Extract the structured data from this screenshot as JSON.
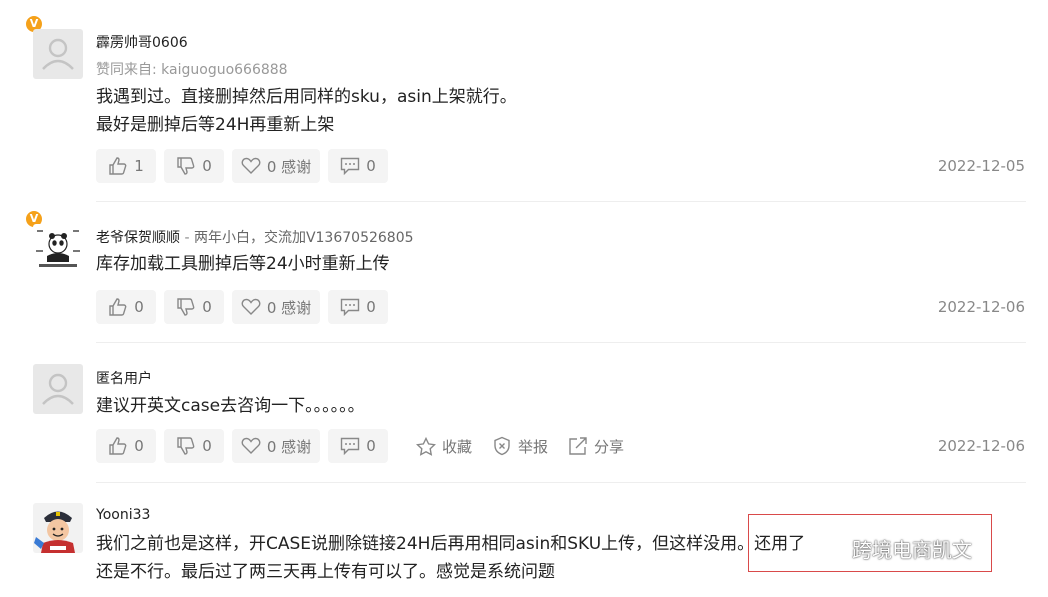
{
  "comments": [
    {
      "username": "霹雳帅哥0606",
      "verified_badge": "V",
      "sub_label": "赞同来自: kaiguoguo666888",
      "body_lines": [
        "我遇到过。直接删掉然后用同样的sku，asin上架就行。",
        "最好是删掉后等24H再重新上架"
      ],
      "likes": "1",
      "dislikes": "0",
      "thanks": "0 感谢",
      "replies": "0",
      "date": "2022-12-05"
    },
    {
      "username": "老爷保贺顺顺",
      "separator": " - ",
      "bio": "两年小白，交流加V13670526805",
      "verified_badge": "V",
      "body_lines": [
        "库存加载工具删掉后等24小时重新上传"
      ],
      "likes": "0",
      "dislikes": "0",
      "thanks": "0 感谢",
      "replies": "0",
      "date": "2022-12-06"
    },
    {
      "username": "匿名用户",
      "body_lines": [
        "建议开英文case去咨询一下。。。。。。"
      ],
      "likes": "0",
      "dislikes": "0",
      "thanks": "0 感谢",
      "replies": "0",
      "collect": "收藏",
      "report": "举报",
      "share": "分享",
      "date": "2022-12-06"
    },
    {
      "username": "Yooni33",
      "body_lines": [
        "我们之前也是这样，开CASE说删除链接24H后再用相同asin和SKU上传，但这样没用。还用了",
        "还是不行。最后过了两三天再上传有可以了。感觉是系统问题"
      ]
    }
  ],
  "watermark": {
    "text": "跨境电商凯文"
  },
  "colors": {
    "badge": "#f5a11a",
    "button_bg": "#f4f4f4",
    "annotation_box": "#d94a4a"
  },
  "icons": [
    "thumbs-up-icon",
    "thumbs-down-icon",
    "heart-icon",
    "comment-icon",
    "star-icon",
    "report-icon",
    "share-icon",
    "wechat-icon"
  ]
}
